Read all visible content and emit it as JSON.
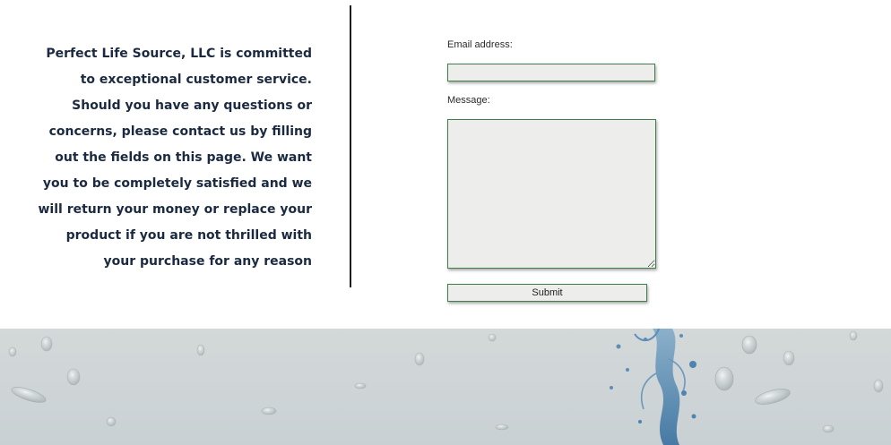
{
  "intro": {
    "text": "Perfect Life Source, LLC is committed to exceptional customer service. Should you have any questions or concerns, please contact us by filling out the fields on this page. We want you to be completely satisfied and we will return your money or replace your product if you are not thrilled with your purchase for any reason"
  },
  "form": {
    "email_label": "Email address:",
    "email_value": "",
    "message_label": "Message:",
    "message_value": "",
    "submit_label": "Submit"
  },
  "colors": {
    "intro_text": "#1b2a40",
    "field_border": "#3f7f4b",
    "field_background": "#ededeb",
    "banner_background": "#d3d8d9",
    "splash": "#3f79a8"
  },
  "icons": {
    "banner": "water-splash-droplets-image"
  }
}
